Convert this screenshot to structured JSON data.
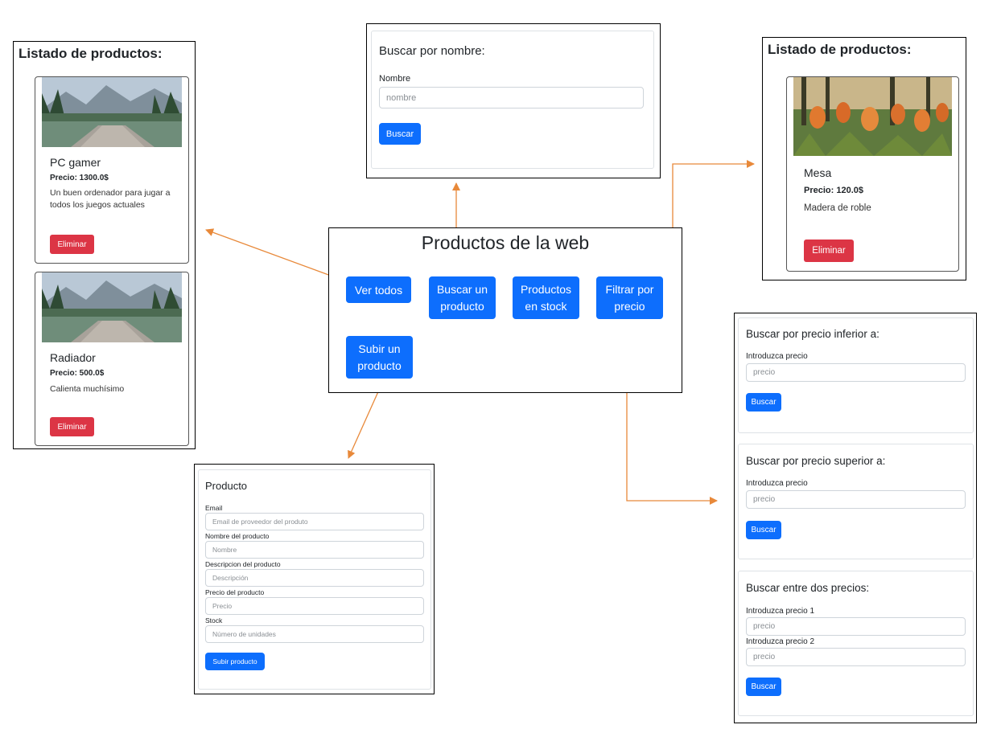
{
  "list_left": {
    "title": "Listado de productos:",
    "products": [
      {
        "name": "PC gamer",
        "price": "Precio: 1300.0$",
        "description": "Un buen ordenador para jugar a todos los juegos actuales",
        "delete_label": "Eliminar",
        "image": "lake-landscape-image"
      },
      {
        "name": "Radiador",
        "price": "Precio: 500.0$",
        "description": "Calienta muchísimo",
        "delete_label": "Eliminar",
        "image": "lake-landscape-image"
      }
    ]
  },
  "search_name": {
    "title": "Buscar por nombre:",
    "field_label": "Nombre",
    "placeholder": "nombre",
    "button": "Buscar"
  },
  "list_right": {
    "title": "Listado de productos:",
    "product": {
      "name": "Mesa",
      "price": "Precio: 120.0$",
      "description": "Madera de roble",
      "delete_label": "Eliminar",
      "image": "flowers-image"
    }
  },
  "main_menu": {
    "title": "Productos de la web",
    "buttons": {
      "ver_todos": "Ver todos",
      "buscar": "Buscar un producto",
      "stock": "Productos en stock",
      "filtrar": "Filtrar por precio",
      "subir": "Subir un producto"
    }
  },
  "price_filter": {
    "inferior": {
      "title": "Buscar por precio inferior a:",
      "label": "Introduzca precio",
      "placeholder": "precio",
      "button": "Buscar"
    },
    "superior": {
      "title": "Buscar por precio superior a:",
      "label": "Introduzca precio",
      "placeholder": "precio",
      "button": "Buscar"
    },
    "entre": {
      "title": "Buscar entre dos precios:",
      "label1": "Introduzca precio 1",
      "placeholder1": "precio",
      "label2": "Introduzca precio 2",
      "placeholder2": "precio",
      "button": "Buscar"
    }
  },
  "product_form": {
    "title": "Producto",
    "fields": [
      {
        "label": "Email",
        "placeholder": "Email de proveedor del produto"
      },
      {
        "label": "Nombre del producto",
        "placeholder": "Nombre"
      },
      {
        "label": "Descripcion del producto",
        "placeholder": "Descripción"
      },
      {
        "label": "Precio del producto",
        "placeholder": "Precio"
      },
      {
        "label": "Stock",
        "placeholder": "Número de unidades"
      }
    ],
    "submit": "Subir producto"
  },
  "colors": {
    "primary": "#0d6efd",
    "danger": "#dc3545",
    "arrow": "#e8893a"
  }
}
